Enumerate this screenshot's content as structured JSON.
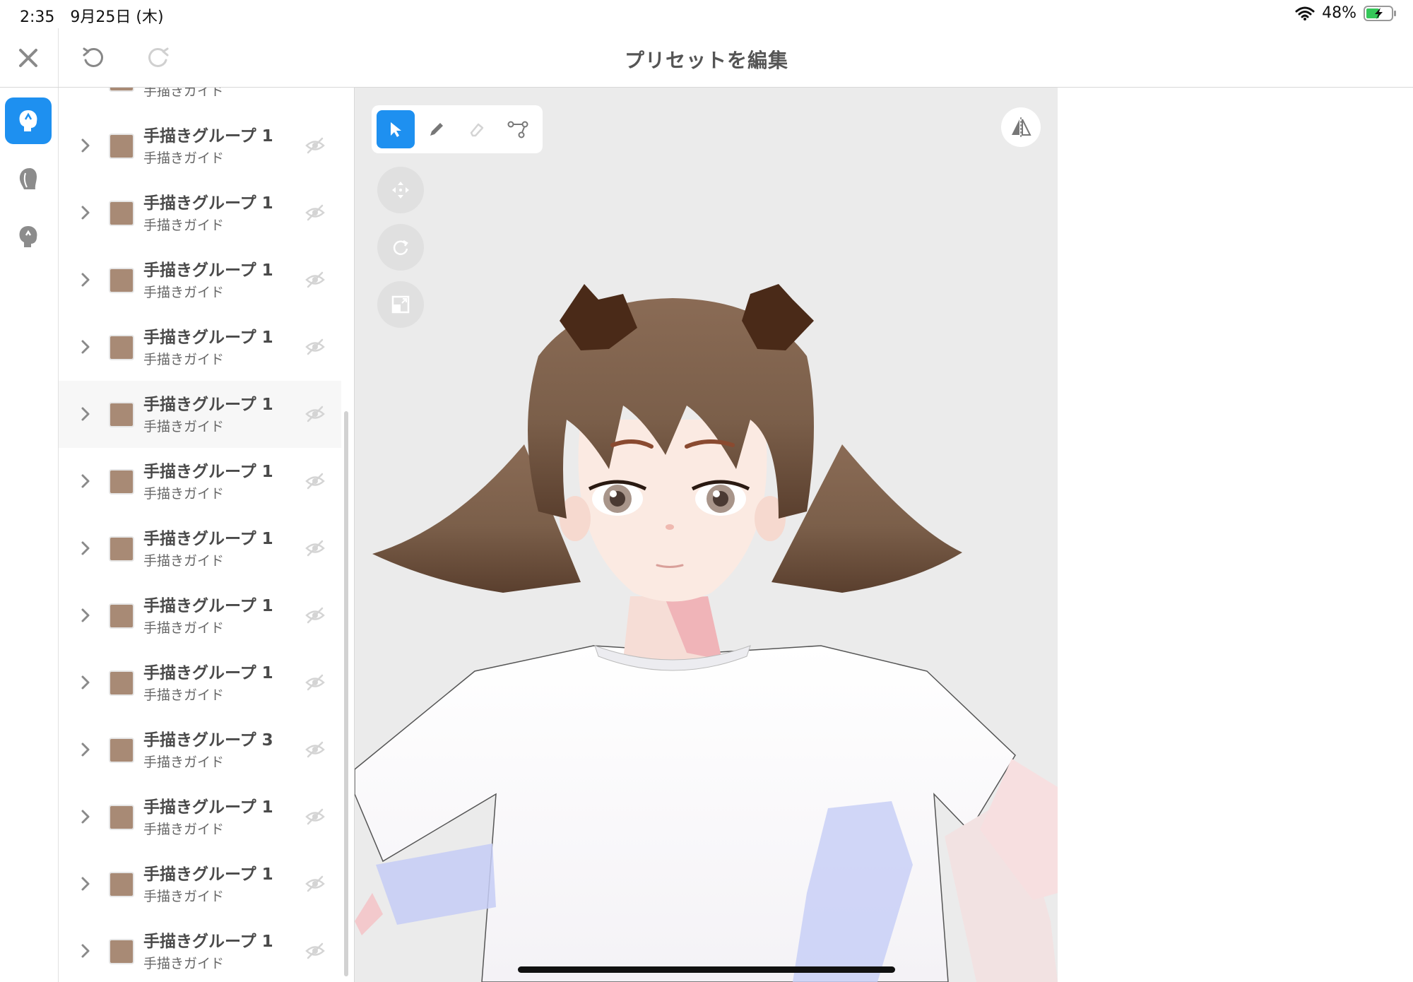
{
  "status_bar": {
    "time": "2:35　9月25日 (木)",
    "battery": "48%"
  },
  "toolbar": {
    "title": "プリセットを編集"
  },
  "rail": {
    "items": [
      {
        "icon": "head-front-icon"
      },
      {
        "icon": "head-back-icon"
      },
      {
        "icon": "head-side-icon"
      }
    ]
  },
  "layers": {
    "partial_top_subtitle": "手描きガイド",
    "items": [
      {
        "title": "手描きグループ 1",
        "subtitle": "手描きガイド"
      },
      {
        "title": "手描きグループ 1",
        "subtitle": "手描きガイド"
      },
      {
        "title": "手描きグループ 1",
        "subtitle": "手描きガイド"
      },
      {
        "title": "手描きグループ 1",
        "subtitle": "手描きガイド"
      },
      {
        "title": "手描きグループ 1",
        "subtitle": "手描きガイド"
      },
      {
        "title": "手描きグループ 1",
        "subtitle": "手描きガイド"
      },
      {
        "title": "手描きグループ 1",
        "subtitle": "手描きガイド"
      },
      {
        "title": "手描きグループ 1",
        "subtitle": "手描きガイド"
      },
      {
        "title": "手描きグループ 1",
        "subtitle": "手描きガイド"
      },
      {
        "title": "手描きグループ 3",
        "subtitle": "手描きガイド"
      },
      {
        "title": "手描きグループ 1",
        "subtitle": "手描きガイド"
      },
      {
        "title": "手描きグループ 1",
        "subtitle": "手描きガイド"
      },
      {
        "title": "手描きグループ 1",
        "subtitle": "手描きガイド"
      }
    ],
    "swatch_color": "#a88a75"
  },
  "viewport": {
    "tools": [
      "select-arrow-icon",
      "pen-icon",
      "eraser-icon",
      "path-icon"
    ],
    "active_tool": "select-arrow-icon",
    "accent": "#1e90f0"
  }
}
